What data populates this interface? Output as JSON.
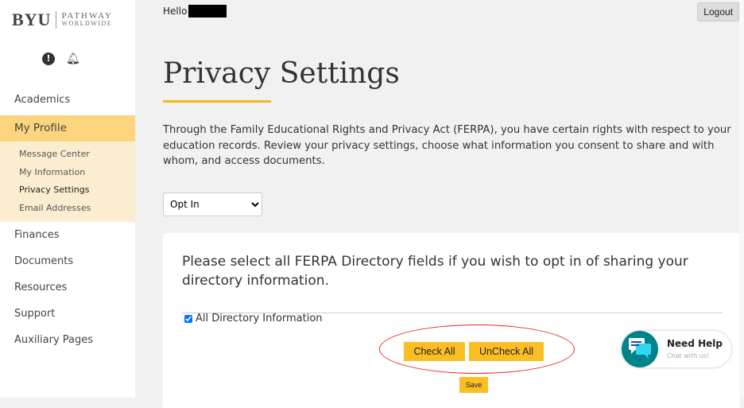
{
  "brand": {
    "logo_main": "BYU",
    "logo_line1": "PATHWAY",
    "logo_line2": "WORLDWIDE"
  },
  "sidebar": {
    "items": [
      {
        "label": "Academics"
      },
      {
        "label": "My Profile",
        "active": true
      },
      {
        "label": "Finances"
      },
      {
        "label": "Documents"
      },
      {
        "label": "Resources"
      },
      {
        "label": "Support"
      },
      {
        "label": "Auxiliary Pages"
      }
    ],
    "sub_items": [
      {
        "label": "Message Center"
      },
      {
        "label": "My Information"
      },
      {
        "label": "Privacy Settings",
        "current": true
      },
      {
        "label": "Email Addresses"
      }
    ]
  },
  "header": {
    "greeting": "Hello",
    "logout_label": "Logout"
  },
  "main": {
    "title": "Privacy Settings",
    "intro": "Through the Family Educational Rights and Privacy Act (FERPA), you have certain rights with respect to your education records. Review your privacy settings, choose what information you consent to share and with whom, and access documents.",
    "opt_select": "Opt In",
    "card": {
      "question": "Please select all FERPA Directory fields if you wish to opt in of sharing your directory information.",
      "checkbox_label": "All Directory Information",
      "checkbox_checked": true,
      "check_all": "Check All",
      "uncheck_all": "UnCheck All",
      "save": "Save"
    }
  },
  "chat": {
    "title": "Need Help",
    "subtitle": "Chat with us!"
  },
  "colors": {
    "accent": "#fbbf24",
    "active_nav": "#fed57f",
    "sub_nav": "#fdedd0",
    "chat": "#00838a",
    "annotation": "#e22222"
  }
}
